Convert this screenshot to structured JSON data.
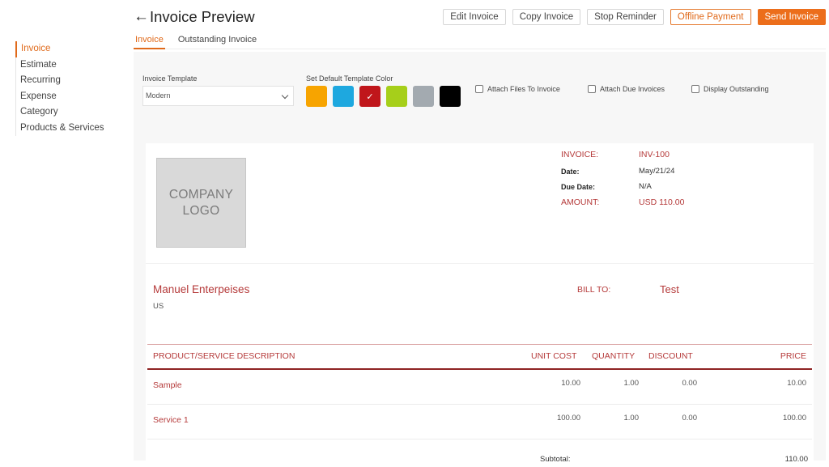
{
  "sidebar": {
    "items": [
      {
        "label": "Invoice",
        "active": true
      },
      {
        "label": "Estimate"
      },
      {
        "label": "Recurring"
      },
      {
        "label": "Expense"
      },
      {
        "label": "Category"
      },
      {
        "label": "Products & Services"
      }
    ]
  },
  "header": {
    "back_icon": "←",
    "title": "Invoice Preview",
    "actions": {
      "edit": "Edit Invoice",
      "copy": "Copy Invoice",
      "stop_reminder": "Stop Reminder",
      "offline_payment": "Offline Payment",
      "send": "Send Invoice"
    }
  },
  "tabs": [
    {
      "label": "Invoice",
      "active": true
    },
    {
      "label": "Outstanding Invoice"
    }
  ],
  "settings": {
    "template_label": "Invoice Template",
    "template_value": "Modern",
    "color_label": "Set Default Template Color",
    "colors": [
      "#f7a400",
      "#1ea8df",
      "#c0161b",
      "#a6cf1a",
      "#a3aab0",
      "#000000"
    ],
    "selected_color_check": "✓",
    "checkboxes": {
      "attach_files": "Attach Files To Invoice",
      "attach_due": "Attach Due Invoices",
      "display_outstanding": "Display Outstanding"
    }
  },
  "invoice": {
    "logo_text": "COMPANY\nLOGO",
    "invoice_label": "INVOICE:",
    "invoice_number": "INV-100",
    "date_label": "Date:",
    "date_value": "May/21/24",
    "due_label": "Due Date:",
    "due_value": "N/A",
    "amount_label": "AMOUNT:",
    "amount_value": "USD 110.00",
    "company_name": "Manuel Enterpeises",
    "company_country": "US",
    "bill_to_label": "BILL TO:",
    "bill_to_name": "Test",
    "columns": {
      "description": "PRODUCT/SERVICE DESCRIPTION",
      "unit_cost": "UNIT COST",
      "quantity": "QUANTITY",
      "discount": "DISCOUNT",
      "price": "PRICE"
    },
    "rows": [
      {
        "name": "Sample",
        "unit_cost": "10.00",
        "quantity": "1.00",
        "discount": "0.00",
        "price": "10.00"
      },
      {
        "name": "Service 1",
        "unit_cost": "100.00",
        "quantity": "1.00",
        "discount": "0.00",
        "price": "100.00"
      }
    ],
    "subtotal_label": "Subtotal:",
    "subtotal_value": "110.00"
  }
}
